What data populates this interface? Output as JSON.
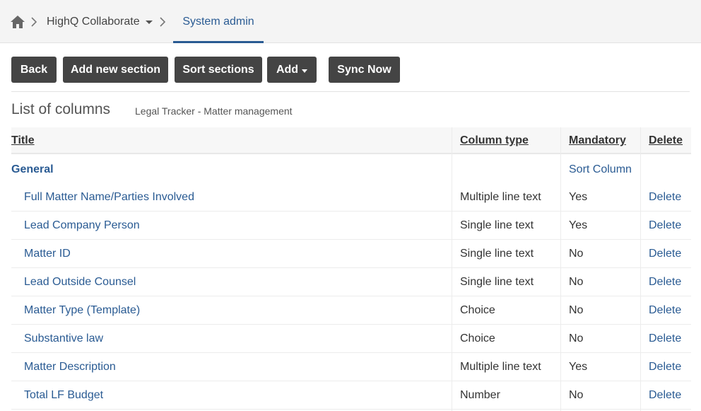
{
  "breadcrumb": {
    "app": "HighQ Collaborate",
    "active": "System admin"
  },
  "toolbar": {
    "back": "Back",
    "add_section": "Add new section",
    "sort_sections": "Sort sections",
    "add": "Add",
    "sync": "Sync Now"
  },
  "page": {
    "title": "List of columns",
    "subtitle": "Legal Tracker - Matter management"
  },
  "table": {
    "headers": {
      "title": "Title",
      "type": "Column type",
      "mandatory": "Mandatory",
      "delete": "Delete"
    },
    "section": {
      "name": "General",
      "sort_label": "Sort Column"
    },
    "rows": [
      {
        "title": "Full Matter Name/Parties Involved",
        "type": "Multiple line text",
        "mandatory": "Yes",
        "delete": "Delete"
      },
      {
        "title": "Lead Company Person",
        "type": "Single line text",
        "mandatory": "Yes",
        "delete": "Delete"
      },
      {
        "title": "Matter ID",
        "type": "Single line text",
        "mandatory": "No",
        "delete": "Delete"
      },
      {
        "title": "Lead Outside Counsel",
        "type": "Single line text",
        "mandatory": "No",
        "delete": "Delete"
      },
      {
        "title": "Matter Type (Template)",
        "type": "Choice",
        "mandatory": "No",
        "delete": "Delete"
      },
      {
        "title": "Substantive law",
        "type": "Choice",
        "mandatory": "No",
        "delete": "Delete"
      },
      {
        "title": "Matter Description",
        "type": "Multiple line text",
        "mandatory": "Yes",
        "delete": "Delete"
      },
      {
        "title": "Total LF Budget",
        "type": "Number",
        "mandatory": "No",
        "delete": "Delete"
      }
    ]
  },
  "colors": {
    "link": "#2a5b93",
    "button_bg": "#444444"
  },
  "icons": {
    "home": "home-icon",
    "separator": "chevron-right-icon",
    "dropdown": "caret-down-icon"
  }
}
